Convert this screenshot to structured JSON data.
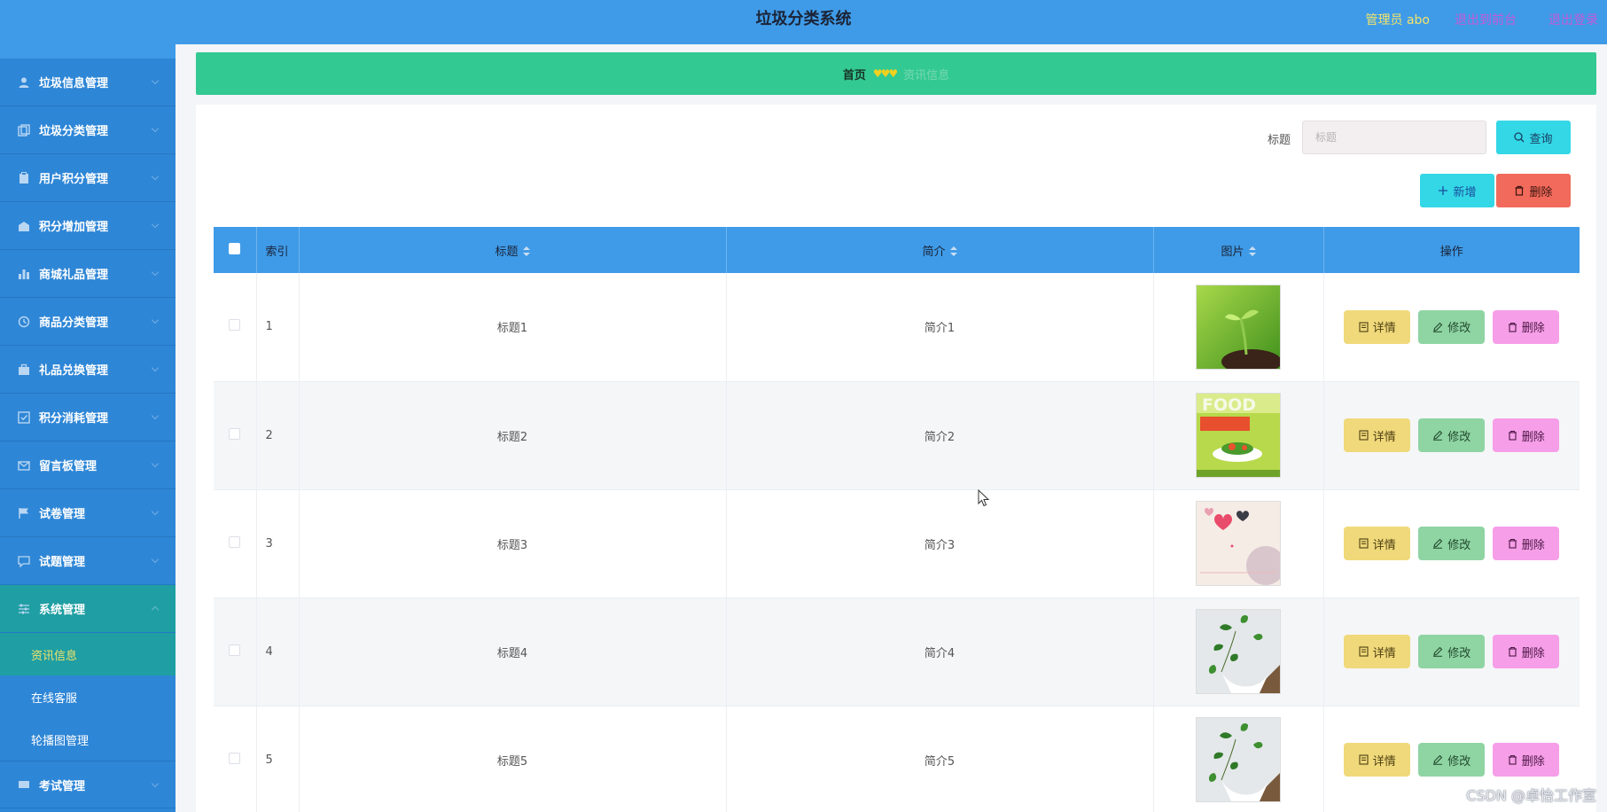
{
  "header": {
    "title": "垃圾分类系统",
    "admin_label": "管理员 abo",
    "back_link": "退出到前台",
    "logout_link": "退出登录"
  },
  "sidebar": {
    "items": [
      {
        "label": "垃圾信息管理",
        "icon": "user-icon"
      },
      {
        "label": "垃圾分类管理",
        "icon": "copy-icon"
      },
      {
        "label": "用户积分管理",
        "icon": "clipboard-icon"
      },
      {
        "label": "积分增加管理",
        "icon": "shop-icon"
      },
      {
        "label": "商城礼品管理",
        "icon": "bar-chart-icon"
      },
      {
        "label": "商品分类管理",
        "icon": "clock-icon"
      },
      {
        "label": "礼品兑换管理",
        "icon": "briefcase-icon"
      },
      {
        "label": "积分消耗管理",
        "icon": "check-square-icon"
      },
      {
        "label": "留言板管理",
        "icon": "mail-icon"
      },
      {
        "label": "试卷管理",
        "icon": "flag-icon"
      },
      {
        "label": "试题管理",
        "icon": "chat-icon"
      },
      {
        "label": "系统管理",
        "icon": "sliders-icon"
      }
    ],
    "sub_items": [
      {
        "label": "资讯信息"
      },
      {
        "label": "在线客服"
      },
      {
        "label": "轮播图管理"
      }
    ],
    "last_item": {
      "label": "考试管理",
      "icon": "keyboard-icon"
    }
  },
  "breadcrumb": {
    "home": "首页",
    "separator": "♥♥♥",
    "current": "资讯信息"
  },
  "search": {
    "label": "标题",
    "placeholder": "标题",
    "query_button": "查询"
  },
  "toolbar": {
    "add_button": "新增",
    "delete_button": "删除"
  },
  "table": {
    "headers": {
      "index": "索引",
      "title": "标题",
      "intro": "简介",
      "image": "图片",
      "actions": "操作"
    },
    "rows": [
      {
        "index": "1",
        "title": "标题1",
        "intro": "简介1",
        "image": "seedling-photo"
      },
      {
        "index": "2",
        "title": "标题2",
        "intro": "简介2",
        "image": "food-cover-photo"
      },
      {
        "index": "3",
        "title": "标题3",
        "intro": "简介3",
        "image": "hearts-card-photo"
      },
      {
        "index": "4",
        "title": "标题4",
        "intro": "简介4",
        "image": "potted-plant-photo"
      },
      {
        "index": "5",
        "title": "标题5",
        "intro": "简介5",
        "image": "potted-plant-photo"
      }
    ],
    "row_actions": {
      "detail": "详情",
      "edit": "修改",
      "remove": "删除"
    }
  },
  "watermark": "CSDN @卓怡工作室",
  "colors": {
    "header_bg": "#3f9be8",
    "sidebar_bg": "#2e86d6",
    "breadcrumb_bg": "#33c992",
    "query_button": "#33d7e6",
    "delete_button": "#f26a5b",
    "detail_button": "#f0d97b",
    "edit_button": "#8fd4a3",
    "remove_button": "#f69ee8"
  }
}
